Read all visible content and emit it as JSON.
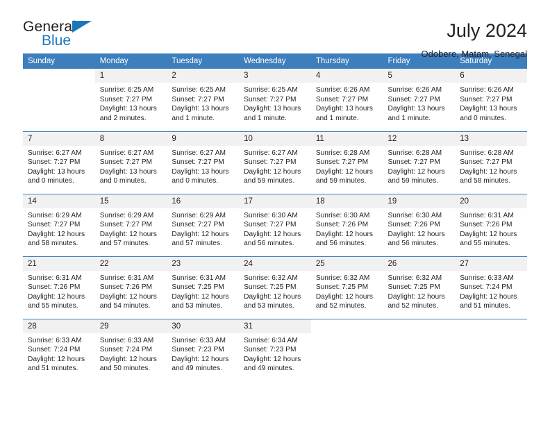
{
  "brand": {
    "name_top": "General",
    "name_bottom": "Blue",
    "triangle_icon": "triangle-icon",
    "accent_color": "#1c76bc"
  },
  "header": {
    "title": "July 2024",
    "subtitle": "Odobere, Matam, Senegal"
  },
  "calendar": {
    "header_bg": "#3d7ebd",
    "daynum_bg": "#f1f1f1",
    "weekday_headers": [
      "Sunday",
      "Monday",
      "Tuesday",
      "Wednesday",
      "Thursday",
      "Friday",
      "Saturday"
    ],
    "weeks": [
      [
        {
          "day": ""
        },
        {
          "day": "1",
          "sunrise": "Sunrise: 6:25 AM",
          "sunset": "Sunset: 7:27 PM",
          "daylight_1": "Daylight: 13 hours",
          "daylight_2": "and 2 minutes."
        },
        {
          "day": "2",
          "sunrise": "Sunrise: 6:25 AM",
          "sunset": "Sunset: 7:27 PM",
          "daylight_1": "Daylight: 13 hours",
          "daylight_2": "and 1 minute."
        },
        {
          "day": "3",
          "sunrise": "Sunrise: 6:25 AM",
          "sunset": "Sunset: 7:27 PM",
          "daylight_1": "Daylight: 13 hours",
          "daylight_2": "and 1 minute."
        },
        {
          "day": "4",
          "sunrise": "Sunrise: 6:26 AM",
          "sunset": "Sunset: 7:27 PM",
          "daylight_1": "Daylight: 13 hours",
          "daylight_2": "and 1 minute."
        },
        {
          "day": "5",
          "sunrise": "Sunrise: 6:26 AM",
          "sunset": "Sunset: 7:27 PM",
          "daylight_1": "Daylight: 13 hours",
          "daylight_2": "and 1 minute."
        },
        {
          "day": "6",
          "sunrise": "Sunrise: 6:26 AM",
          "sunset": "Sunset: 7:27 PM",
          "daylight_1": "Daylight: 13 hours",
          "daylight_2": "and 0 minutes."
        }
      ],
      [
        {
          "day": "7",
          "sunrise": "Sunrise: 6:27 AM",
          "sunset": "Sunset: 7:27 PM",
          "daylight_1": "Daylight: 13 hours",
          "daylight_2": "and 0 minutes."
        },
        {
          "day": "8",
          "sunrise": "Sunrise: 6:27 AM",
          "sunset": "Sunset: 7:27 PM",
          "daylight_1": "Daylight: 13 hours",
          "daylight_2": "and 0 minutes."
        },
        {
          "day": "9",
          "sunrise": "Sunrise: 6:27 AM",
          "sunset": "Sunset: 7:27 PM",
          "daylight_1": "Daylight: 13 hours",
          "daylight_2": "and 0 minutes."
        },
        {
          "day": "10",
          "sunrise": "Sunrise: 6:27 AM",
          "sunset": "Sunset: 7:27 PM",
          "daylight_1": "Daylight: 12 hours",
          "daylight_2": "and 59 minutes."
        },
        {
          "day": "11",
          "sunrise": "Sunrise: 6:28 AM",
          "sunset": "Sunset: 7:27 PM",
          "daylight_1": "Daylight: 12 hours",
          "daylight_2": "and 59 minutes."
        },
        {
          "day": "12",
          "sunrise": "Sunrise: 6:28 AM",
          "sunset": "Sunset: 7:27 PM",
          "daylight_1": "Daylight: 12 hours",
          "daylight_2": "and 59 minutes."
        },
        {
          "day": "13",
          "sunrise": "Sunrise: 6:28 AM",
          "sunset": "Sunset: 7:27 PM",
          "daylight_1": "Daylight: 12 hours",
          "daylight_2": "and 58 minutes."
        }
      ],
      [
        {
          "day": "14",
          "sunrise": "Sunrise: 6:29 AM",
          "sunset": "Sunset: 7:27 PM",
          "daylight_1": "Daylight: 12 hours",
          "daylight_2": "and 58 minutes."
        },
        {
          "day": "15",
          "sunrise": "Sunrise: 6:29 AM",
          "sunset": "Sunset: 7:27 PM",
          "daylight_1": "Daylight: 12 hours",
          "daylight_2": "and 57 minutes."
        },
        {
          "day": "16",
          "sunrise": "Sunrise: 6:29 AM",
          "sunset": "Sunset: 7:27 PM",
          "daylight_1": "Daylight: 12 hours",
          "daylight_2": "and 57 minutes."
        },
        {
          "day": "17",
          "sunrise": "Sunrise: 6:30 AM",
          "sunset": "Sunset: 7:27 PM",
          "daylight_1": "Daylight: 12 hours",
          "daylight_2": "and 56 minutes."
        },
        {
          "day": "18",
          "sunrise": "Sunrise: 6:30 AM",
          "sunset": "Sunset: 7:26 PM",
          "daylight_1": "Daylight: 12 hours",
          "daylight_2": "and 56 minutes."
        },
        {
          "day": "19",
          "sunrise": "Sunrise: 6:30 AM",
          "sunset": "Sunset: 7:26 PM",
          "daylight_1": "Daylight: 12 hours",
          "daylight_2": "and 56 minutes."
        },
        {
          "day": "20",
          "sunrise": "Sunrise: 6:31 AM",
          "sunset": "Sunset: 7:26 PM",
          "daylight_1": "Daylight: 12 hours",
          "daylight_2": "and 55 minutes."
        }
      ],
      [
        {
          "day": "21",
          "sunrise": "Sunrise: 6:31 AM",
          "sunset": "Sunset: 7:26 PM",
          "daylight_1": "Daylight: 12 hours",
          "daylight_2": "and 55 minutes."
        },
        {
          "day": "22",
          "sunrise": "Sunrise: 6:31 AM",
          "sunset": "Sunset: 7:26 PM",
          "daylight_1": "Daylight: 12 hours",
          "daylight_2": "and 54 minutes."
        },
        {
          "day": "23",
          "sunrise": "Sunrise: 6:31 AM",
          "sunset": "Sunset: 7:25 PM",
          "daylight_1": "Daylight: 12 hours",
          "daylight_2": "and 53 minutes."
        },
        {
          "day": "24",
          "sunrise": "Sunrise: 6:32 AM",
          "sunset": "Sunset: 7:25 PM",
          "daylight_1": "Daylight: 12 hours",
          "daylight_2": "and 53 minutes."
        },
        {
          "day": "25",
          "sunrise": "Sunrise: 6:32 AM",
          "sunset": "Sunset: 7:25 PM",
          "daylight_1": "Daylight: 12 hours",
          "daylight_2": "and 52 minutes."
        },
        {
          "day": "26",
          "sunrise": "Sunrise: 6:32 AM",
          "sunset": "Sunset: 7:25 PM",
          "daylight_1": "Daylight: 12 hours",
          "daylight_2": "and 52 minutes."
        },
        {
          "day": "27",
          "sunrise": "Sunrise: 6:33 AM",
          "sunset": "Sunset: 7:24 PM",
          "daylight_1": "Daylight: 12 hours",
          "daylight_2": "and 51 minutes."
        }
      ],
      [
        {
          "day": "28",
          "sunrise": "Sunrise: 6:33 AM",
          "sunset": "Sunset: 7:24 PM",
          "daylight_1": "Daylight: 12 hours",
          "daylight_2": "and 51 minutes."
        },
        {
          "day": "29",
          "sunrise": "Sunrise: 6:33 AM",
          "sunset": "Sunset: 7:24 PM",
          "daylight_1": "Daylight: 12 hours",
          "daylight_2": "and 50 minutes."
        },
        {
          "day": "30",
          "sunrise": "Sunrise: 6:33 AM",
          "sunset": "Sunset: 7:23 PM",
          "daylight_1": "Daylight: 12 hours",
          "daylight_2": "and 49 minutes."
        },
        {
          "day": "31",
          "sunrise": "Sunrise: 6:34 AM",
          "sunset": "Sunset: 7:23 PM",
          "daylight_1": "Daylight: 12 hours",
          "daylight_2": "and 49 minutes."
        },
        {
          "day": ""
        },
        {
          "day": ""
        },
        {
          "day": ""
        }
      ]
    ]
  }
}
